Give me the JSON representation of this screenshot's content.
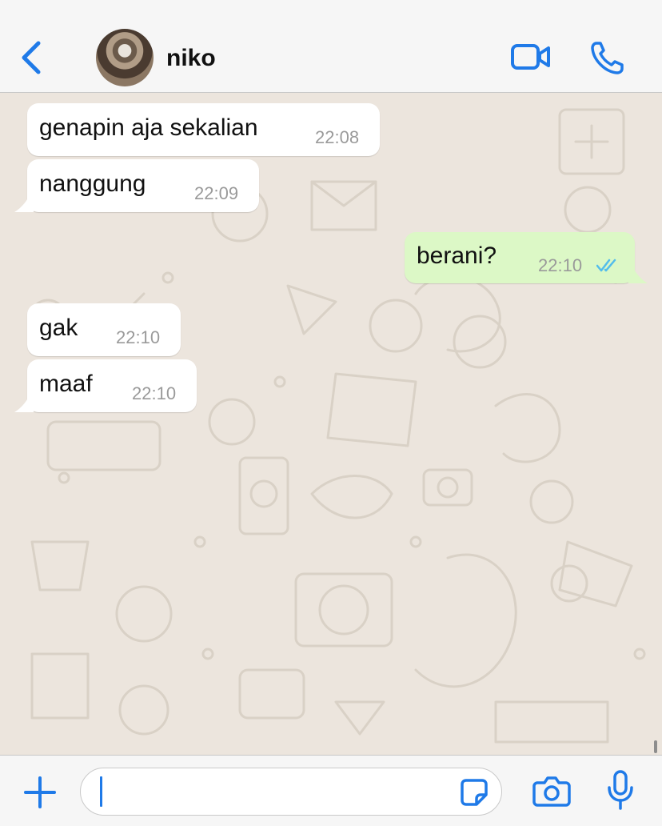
{
  "header": {
    "contact_name": "niko",
    "back_icon": "chevron-left-icon",
    "video_icon": "video-camera-icon",
    "call_icon": "phone-icon"
  },
  "messages": [
    {
      "text": "genapin aja sekalian",
      "time": "22:08",
      "direction": "incoming"
    },
    {
      "text": "nanggung",
      "time": "22:09",
      "direction": "incoming"
    },
    {
      "text": "berani?",
      "time": "22:10",
      "direction": "outgoing",
      "status": "read"
    },
    {
      "text": "gak",
      "time": "22:10",
      "direction": "incoming"
    },
    {
      "text": "maaf",
      "time": "22:10",
      "direction": "incoming"
    }
  ],
  "composer": {
    "value": "",
    "plus_icon": "plus-icon",
    "sticker_icon": "sticker-icon",
    "camera_icon": "camera-icon",
    "mic_icon": "microphone-icon"
  },
  "colors": {
    "accent": "#1f7ae8",
    "chat_background": "#ece5dd",
    "incoming_bubble": "#ffffff",
    "outgoing_bubble": "#dcf8c6",
    "read_ticks": "#53bdeb"
  }
}
